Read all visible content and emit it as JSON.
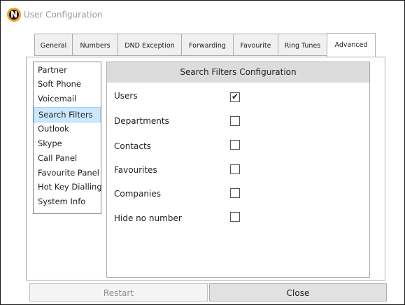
{
  "window": {
    "title": "User Configuration",
    "logo_letter": "N"
  },
  "tabs": [
    {
      "label": "General"
    },
    {
      "label": "Numbers"
    },
    {
      "label": "DND Exception"
    },
    {
      "label": "Forwarding"
    },
    {
      "label": "Favourite"
    },
    {
      "label": "Ring Tunes"
    },
    {
      "label": "Advanced",
      "active": true
    }
  ],
  "sidebar": {
    "items": [
      {
        "label": "Partner"
      },
      {
        "label": "Soft Phone"
      },
      {
        "label": "Voicemail"
      },
      {
        "label": "Search Filters",
        "selected": true
      },
      {
        "label": "Outlook"
      },
      {
        "label": "Skype"
      },
      {
        "label": "Call Panel"
      },
      {
        "label": "Favourite Panel"
      },
      {
        "label": "Hot Key Dialling"
      },
      {
        "label": "System Info"
      }
    ]
  },
  "panel": {
    "title": "Search Filters Configuration",
    "options": [
      {
        "label": "Users",
        "checked": true
      },
      {
        "label": "Departments",
        "checked": false
      },
      {
        "label": "Contacts",
        "checked": false
      },
      {
        "label": "Favourites",
        "checked": false
      },
      {
        "label": "Companies",
        "checked": false
      },
      {
        "label": "Hide no number",
        "checked": false
      }
    ]
  },
  "buttons": {
    "restart_label": "Restart",
    "close_label": "Close"
  },
  "colors": {
    "accent_selected": "#cce8ff",
    "header_bg": "#dcdcdc",
    "logo": "#f0a322"
  }
}
